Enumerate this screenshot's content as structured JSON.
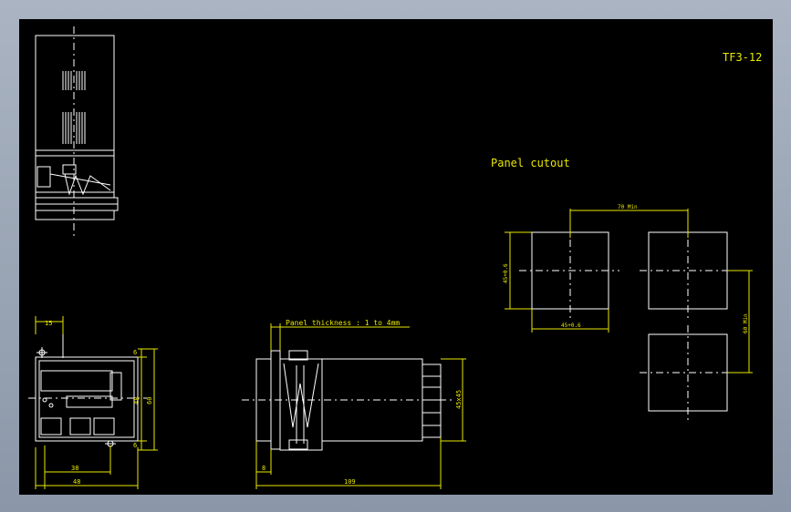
{
  "drawing": {
    "part_no": "TF3-12",
    "cutout_title": "Panel cutout",
    "panel_thickness": "Panel thickness : 1 to 4mm",
    "dims": {
      "d15": "15",
      "d6a": "6",
      "d48v": "48",
      "d60v": "60",
      "d6b": "6",
      "d38": "38",
      "d48h": "48",
      "d8": "8",
      "d109": "109",
      "d45x45": "45x45",
      "d70": "70 Min",
      "d45v": "45+0.6",
      "d45h": "45+0.6",
      "d60min": "60 Min"
    }
  },
  "colors": {
    "background": "#000000",
    "frame": "#9aa4b4",
    "outline": "#ffffff",
    "dimension": "#e8e800"
  }
}
